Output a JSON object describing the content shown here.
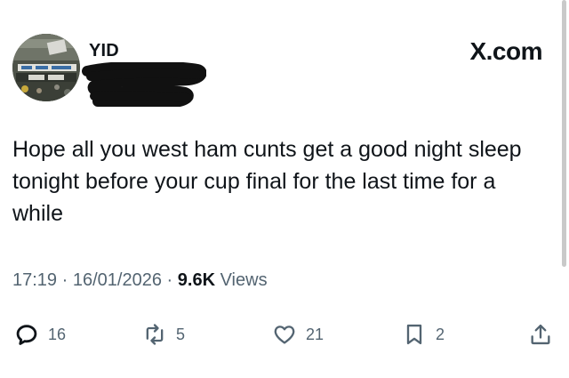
{
  "author": {
    "display_name": "YID"
  },
  "brand": "X.com",
  "tweet": {
    "text": "Hope all you west ham cunts get a good night sleep tonight before your cup final for the last time for a while"
  },
  "meta": {
    "time": "17:19",
    "separator": "·",
    "date": "16/01/2026",
    "views_count": "9.6K",
    "views_label": "Views"
  },
  "actions": {
    "replies": {
      "icon": "reply-icon",
      "count": "16"
    },
    "retweets": {
      "icon": "retweet-icon",
      "count": "5"
    },
    "likes": {
      "icon": "heart-icon",
      "count": "21"
    },
    "bookmarks": {
      "icon": "bookmark-icon",
      "count": "2"
    },
    "share": {
      "icon": "share-icon"
    }
  },
  "colors": {
    "text": "#0f1419",
    "secondary": "#536471",
    "background": "#ffffff"
  }
}
